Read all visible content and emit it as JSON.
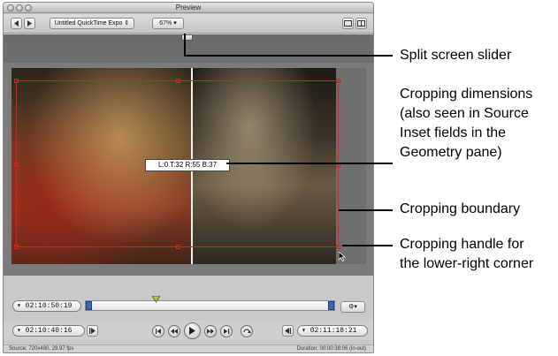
{
  "window": {
    "title": "Preview",
    "source_popup": "Untitled QuickTime Expo",
    "zoom": "67%"
  },
  "viewer": {
    "crop_readout": "L:0 T:32 R:55 B:37"
  },
  "timeline": {
    "current_time": "02:10:50:19"
  },
  "transport": {
    "in_time": "02:10:40:16",
    "out_time": "02:11:18:21"
  },
  "status": {
    "source": "Source: 720x480, 29.97 fps",
    "duration": "Duration: 00:00:38:06 (in-out)"
  },
  "annotations": [
    {
      "id": "split-slider",
      "lines": [
        "Split screen slider"
      ]
    },
    {
      "id": "crop-dimensions",
      "lines": [
        "Cropping dimensions",
        "(also seen in Source",
        "Inset fields in the",
        "Geometry pane)"
      ]
    },
    {
      "id": "crop-boundary",
      "lines": [
        "Cropping boundary"
      ]
    },
    {
      "id": "crop-handle",
      "lines": [
        "Cropping handle for",
        "the lower-right corner"
      ]
    }
  ],
  "colors": {
    "crop": "#e41c1c",
    "window_bg": "#c9c9c9",
    "letterbox": "#7b7b7b"
  }
}
